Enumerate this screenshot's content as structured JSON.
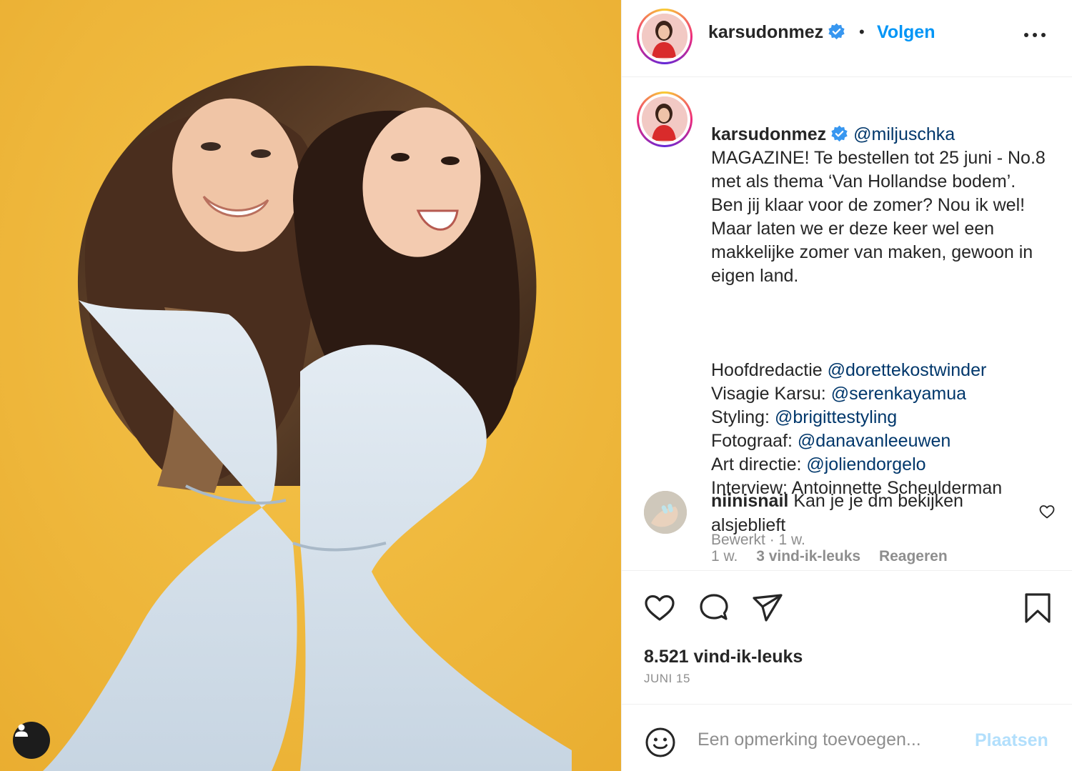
{
  "post": {
    "username": "karsudonmez",
    "follow_label": "Volgen",
    "dot": "•"
  },
  "caption": {
    "username": "karsudonmez",
    "mention": "@miljuschka",
    "text_intro": "MAGAZINE! Te bestellen tot 25 juni - No.8 met als thema ‘Van Hollandse bodem’. Ben jij klaar voor de zomer? Nou ik wel! Maar laten we er deze keer wel een makkelijke zomer van maken, gewoon in eigen land.",
    "credits": [
      {
        "label": "Hoofdredactie ",
        "handle": "@dorettekostwinder"
      },
      {
        "label": "Visagie Karsu: ",
        "handle": "@serenkayamua"
      },
      {
        "label": "Styling: ",
        "handle": "@brigittestyling"
      },
      {
        "label": "Fotograaf: ",
        "handle": "@danavanleeuwen"
      },
      {
        "label": "Art directie: ",
        "handle": "@joliendorgelo"
      },
      {
        "label": "Interview: Antoinnette Scheulderman",
        "handle": ""
      }
    ],
    "meta": "Bewerkt · 1 w."
  },
  "comment": {
    "username": "niinisnail",
    "text": "Kan je je dm bekijken alsjeblieft",
    "time": "1 w.",
    "likes": "3 vind-ik-leuks",
    "reply": "Reageren"
  },
  "stats": {
    "likes": "8.521 vind-ik-leuks",
    "date": "JUNI 15"
  },
  "add_comment": {
    "placeholder": "Een opmerking toevoegen...",
    "post_label": "Plaatsen"
  },
  "colors": {
    "link": "#00376b",
    "follow": "#0095f6",
    "verified": "#3897f0",
    "photo_background": "#f0b93a"
  },
  "icons": [
    "verified-icon",
    "more-options-icon",
    "like-icon",
    "comment-icon",
    "share-icon",
    "save-icon",
    "emoji-icon",
    "comment-like-icon",
    "user-tag-icon"
  ]
}
